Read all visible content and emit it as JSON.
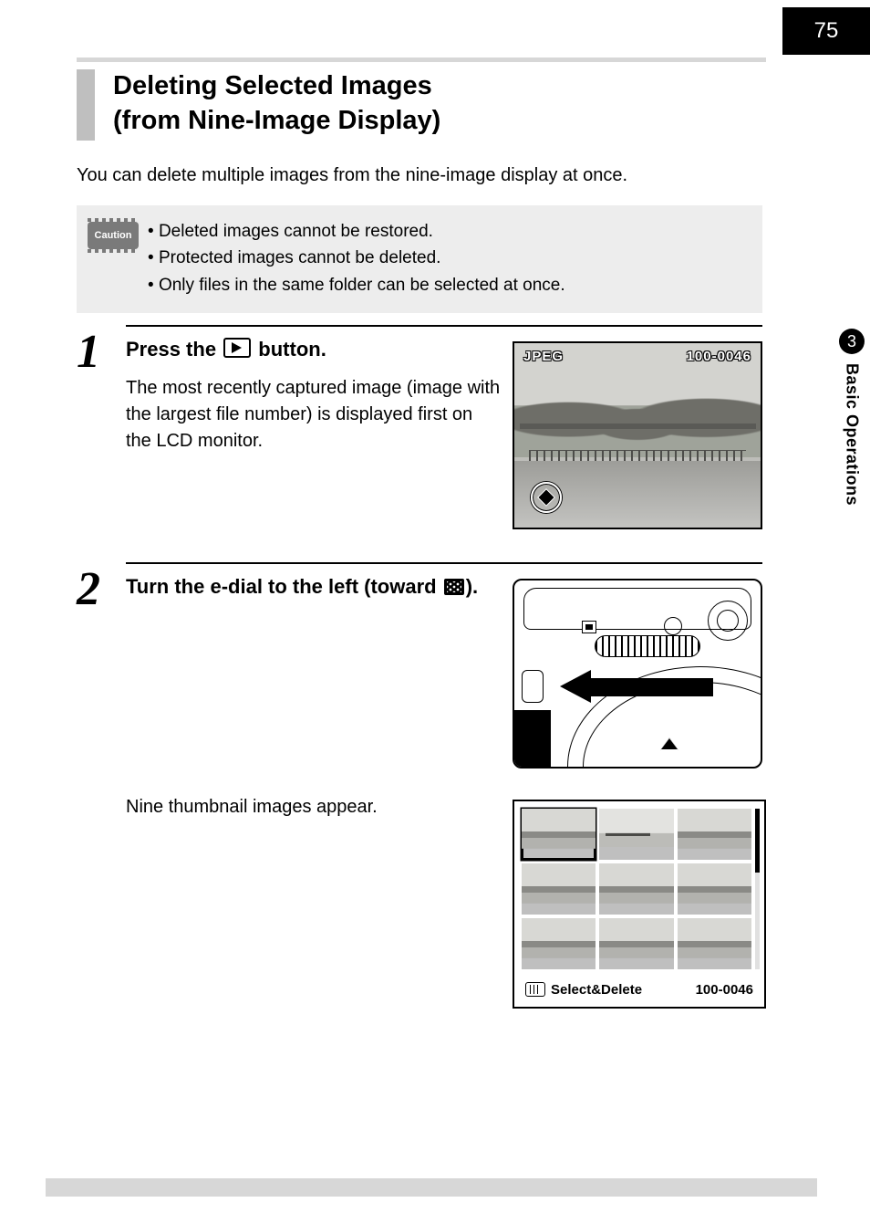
{
  "page_number": "75",
  "chapter": {
    "number": "3",
    "label": "Basic Operations"
  },
  "title_line1": "Deleting Selected Images",
  "title_line2": "(from Nine-Image Display)",
  "intro": "You can delete multiple images from the nine-image display at once.",
  "caution": {
    "badge": "Caution",
    "items": [
      "Deleted images cannot be restored.",
      "Protected images cannot be deleted.",
      "Only files in the same folder can be selected at once."
    ]
  },
  "steps": {
    "s1": {
      "num": "1",
      "heading_pre": "Press the ",
      "heading_post": " button.",
      "desc": "The most recently captured image (image with the largest file number) is displayed first on the LCD monitor.",
      "lcd": {
        "format": "JPEG",
        "file_no": "100-0046"
      }
    },
    "s2": {
      "num": "2",
      "heading_pre": "Turn the e-dial to the left (toward ",
      "heading_post": ").",
      "desc2": "Nine thumbnail images appear.",
      "footer_label": "Select&Delete",
      "footer_file_no": "100-0046"
    }
  }
}
